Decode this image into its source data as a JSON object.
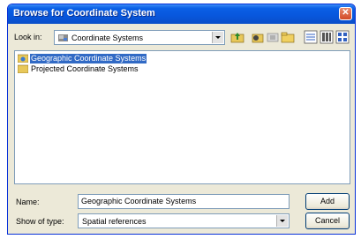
{
  "window": {
    "title": "Browse for Coordinate System",
    "close_glyph": "✕"
  },
  "lookin": {
    "label": "Look in:",
    "value": "Coordinate Systems"
  },
  "toolbar": [
    "up-folder-icon",
    "connect-folder-icon",
    "add-icon",
    "new-folder-icon",
    "list-view-icon",
    "details-view-icon",
    "thumbnails-view-icon"
  ],
  "files": [
    {
      "name": "Geographic Coordinate Systems",
      "selected": true
    },
    {
      "name": "Projected Coordinate Systems",
      "selected": false
    }
  ],
  "name_field": {
    "label": "Name:",
    "value": "Geographic Coordinate Systems"
  },
  "type_field": {
    "label": "Show of type:",
    "value": "Spatial references"
  },
  "buttons": {
    "add": "Add",
    "cancel": "Cancel"
  },
  "colors": {
    "title_bar": "#0856dc",
    "selection": "#316ac5",
    "dialog_bg": "#ece9d8"
  }
}
